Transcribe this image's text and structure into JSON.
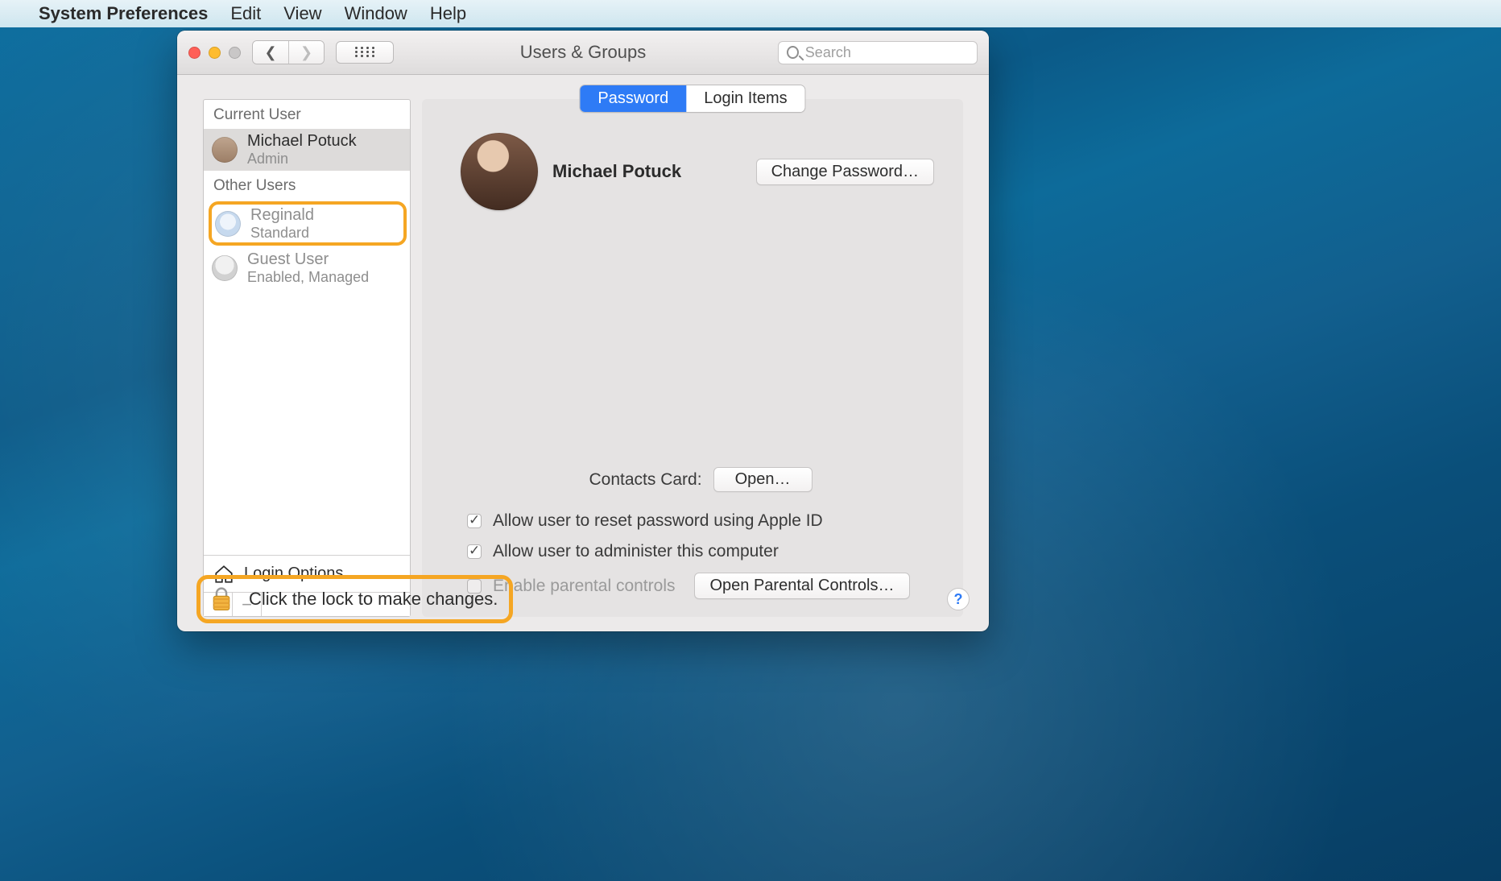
{
  "menubar": {
    "app_name": "System Preferences",
    "items": [
      "Edit",
      "View",
      "Window",
      "Help"
    ]
  },
  "window": {
    "title": "Users & Groups",
    "search_placeholder": "Search"
  },
  "sidebar": {
    "current_label": "Current User",
    "other_label": "Other Users",
    "current_user": {
      "name": "Michael Potuck",
      "role": "Admin"
    },
    "other_users": [
      {
        "name": "Reginald",
        "role": "Standard",
        "highlighted": true
      },
      {
        "name": "Guest User",
        "role": "Enabled, Managed"
      }
    ],
    "login_options_label": "Login Options"
  },
  "tabs": {
    "password": "Password",
    "login_items": "Login Items",
    "active": "password"
  },
  "panel": {
    "user_name": "Michael Potuck",
    "change_password_btn": "Change Password…",
    "contacts_card_label": "Contacts Card:",
    "open_btn": "Open…",
    "chk_reset_appleid": "Allow user to reset password using Apple ID",
    "chk_administer": "Allow user to administer this computer",
    "chk_parental": "Enable parental controls",
    "open_parental_btn": "Open Parental Controls…"
  },
  "footer": {
    "lock_text": "Click the lock to make changes.",
    "help": "?"
  },
  "highlight_color": "#f5a623"
}
